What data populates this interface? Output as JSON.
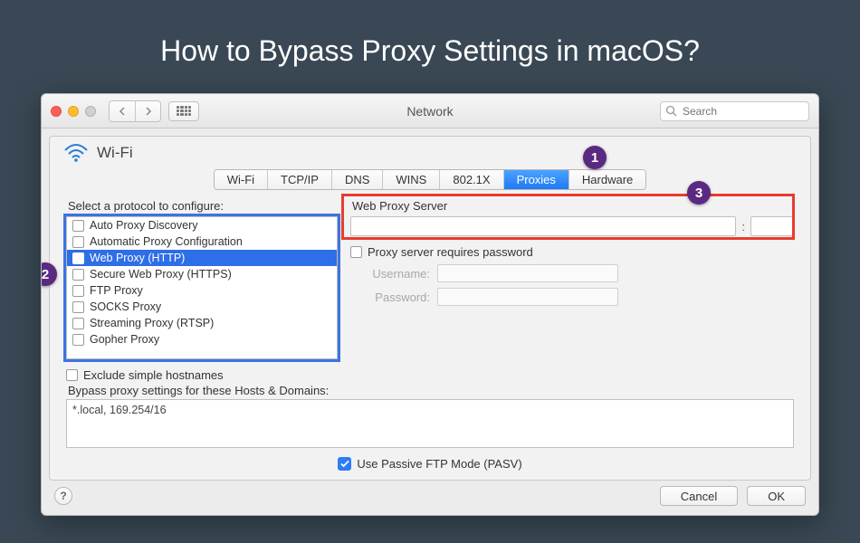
{
  "page_title": "How to Bypass Proxy Settings in macOS?",
  "window": {
    "title": "Network",
    "search_placeholder": "Search"
  },
  "wifi_label": "Wi-Fi",
  "tabs": [
    "Wi-Fi",
    "TCP/IP",
    "DNS",
    "WINS",
    "802.1X",
    "Proxies",
    "Hardware"
  ],
  "active_tab": "Proxies",
  "badges": {
    "one": "1",
    "two": "2",
    "three": "3"
  },
  "protocol": {
    "label": "Select a protocol to configure:",
    "items": [
      "Auto Proxy Discovery",
      "Automatic Proxy Configuration",
      "Web Proxy (HTTP)",
      "Secure Web Proxy (HTTPS)",
      "FTP Proxy",
      "SOCKS Proxy",
      "Streaming Proxy (RTSP)",
      "Gopher Proxy"
    ],
    "selected": "Web Proxy (HTTP)"
  },
  "server": {
    "label": "Web Proxy Server",
    "colon": ":",
    "requires_password_label": "Proxy server requires password",
    "username_label": "Username:",
    "password_label": "Password:"
  },
  "exclude_label": "Exclude simple hostnames",
  "bypass": {
    "label": "Bypass proxy settings for these Hosts & Domains:",
    "value": "*.local, 169.254/16"
  },
  "pasv_label": "Use Passive FTP Mode (PASV)",
  "buttons": {
    "cancel": "Cancel",
    "ok": "OK",
    "help": "?"
  }
}
